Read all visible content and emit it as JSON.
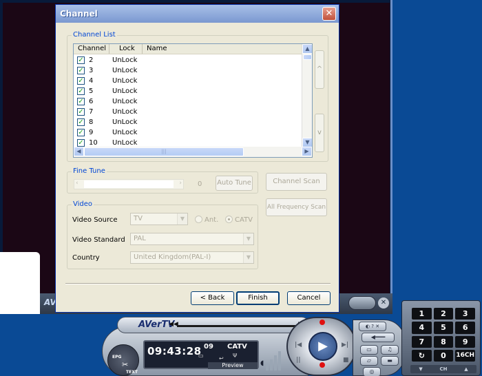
{
  "dialog": {
    "title": "Channel",
    "close_glyph": "✕"
  },
  "channel_list": {
    "label": "Channel List",
    "columns": [
      "Channel",
      "Lock",
      "Name"
    ],
    "rows": [
      {
        "channel": "2",
        "lock": "UnLock",
        "checked": true
      },
      {
        "channel": "3",
        "lock": "UnLock",
        "checked": true
      },
      {
        "channel": "4",
        "lock": "UnLock",
        "checked": true
      },
      {
        "channel": "5",
        "lock": "UnLock",
        "checked": true
      },
      {
        "channel": "6",
        "lock": "UnLock",
        "checked": true
      },
      {
        "channel": "7",
        "lock": "UnLock",
        "checked": true
      },
      {
        "channel": "8",
        "lock": "UnLock",
        "checked": true
      },
      {
        "channel": "9",
        "lock": "UnLock",
        "checked": true
      },
      {
        "channel": "10",
        "lock": "UnLock",
        "checked": true
      }
    ],
    "up_glyph": "^",
    "down_glyph": "v"
  },
  "fine_tune": {
    "label": "Fine Tune",
    "value": "0",
    "auto_tune_label": "Auto Tune"
  },
  "buttons": {
    "channel_scan": "Channel Scan",
    "all_frequency_scan": "All Frequency Scan",
    "back": "< Back",
    "finish": "Finish",
    "cancel": "Cancel"
  },
  "video": {
    "label": "Video",
    "source_label": "Video Source",
    "source_value": "TV",
    "ant_label": "Ant.",
    "catv_label": "CATV",
    "selected_radio": "CATV",
    "standard_label": "Video Standard",
    "standard_value": "PAL",
    "country_label": "Country",
    "country_value": "United Kingdom(PAL-I)"
  },
  "avertv": {
    "logo": "AVerTV",
    "time": "09:43:28",
    "channel": "09",
    "source": "CATV",
    "mode": "Preview",
    "epg": "EPG",
    "text": "TEXT"
  },
  "numpad": {
    "keys": [
      "1",
      "2",
      "3",
      "4",
      "5",
      "6",
      "7",
      "8",
      "9",
      "↻",
      "0",
      "16CH"
    ],
    "bar_label": "CH"
  },
  "colors": {
    "titlebar": "#7b98d0",
    "group_label": "#0046d5",
    "desktop": "#0a4a95"
  }
}
